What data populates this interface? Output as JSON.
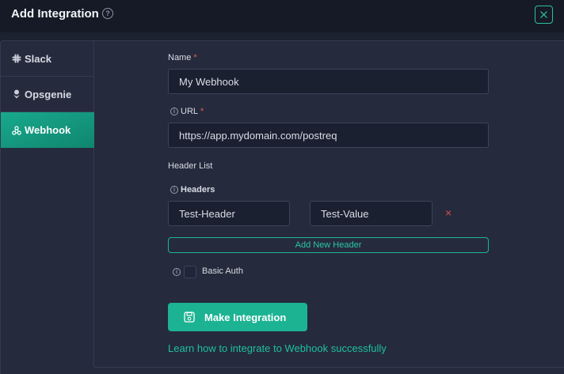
{
  "header": {
    "title": "Add Integration",
    "help_icon": "question-circle-icon",
    "close_icon": "close-icon"
  },
  "sidebar": {
    "items": [
      {
        "label": "Slack",
        "icon": "slack-icon",
        "active": false
      },
      {
        "label": "Opsgenie",
        "icon": "opsgenie-icon",
        "active": false
      },
      {
        "label": "Webhook",
        "icon": "webhook-icon",
        "active": true
      }
    ]
  },
  "form": {
    "name_label": "Name",
    "name_value": "My Webhook",
    "url_label": "URL",
    "url_value": "https://app.mydomain.com/postreq",
    "required_mark": "*",
    "header_list_label": "Header List",
    "headers_label": "Headers",
    "headers": [
      {
        "key": "Test-Header",
        "value": "Test-Value"
      }
    ],
    "remove_symbol": "×",
    "add_header_label": "Add New Header",
    "basic_auth_label": "Basic Auth",
    "basic_auth_checked": false,
    "submit_label": "Make Integration",
    "learn_link": "Learn how to integrate to Webhook successfully"
  },
  "colors": {
    "accent": "#1cb393",
    "background": "#252b3c",
    "required": "#e35a5a"
  }
}
